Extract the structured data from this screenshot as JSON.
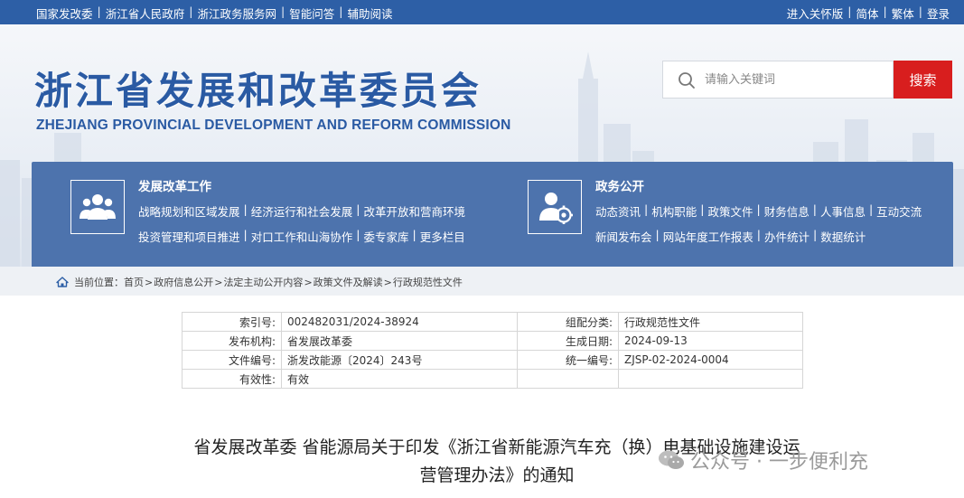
{
  "topbar": {
    "left_links": [
      "国家发改委",
      "浙江省人民政府",
      "浙江政务服务网",
      "智能问答",
      "辅助阅读"
    ],
    "right_links": [
      "进入关怀版",
      "简体",
      "繁体",
      "登录"
    ]
  },
  "header": {
    "title_cn": "浙江省发展和改革委员会",
    "title_en": "ZHEJIANG PROVINCIAL DEVELOPMENT AND REFORM COMMISSION"
  },
  "search": {
    "placeholder": "请输入关键词",
    "button_label": "搜索"
  },
  "nav": {
    "reform": {
      "title": "发展改革工作",
      "line1": [
        "战略规划和区域发展",
        "经济运行和社会发展",
        "改革开放和营商环境"
      ],
      "line2": [
        "投资管理和项目推进",
        "对口工作和山海协作",
        "委专家库",
        "更多栏目"
      ]
    },
    "gov": {
      "title": "政务公开",
      "line1": [
        "动态资讯",
        "机构职能",
        "政策文件",
        "财务信息",
        "人事信息",
        "互动交流"
      ],
      "line2": [
        "新闻发布会",
        "网站年度工作报表",
        "办件统计",
        "数据统计"
      ]
    }
  },
  "breadcrumb": {
    "prefix": "当前位置：",
    "items": [
      "首页",
      "政府信息公开",
      "法定主动公开内容",
      "政策文件及解读",
      "行政规范性文件"
    ]
  },
  "info": {
    "index_label": "索引号:",
    "index_value": "002482031/2024-38924",
    "category_label": "组配分类:",
    "category_value": "行政规范性文件",
    "publisher_label": "发布机构:",
    "publisher_value": "省发展改革委",
    "date_label": "生成日期:",
    "date_value": "2024-09-13",
    "docno_label": "文件编号:",
    "docno_value": "浙发改能源〔2024〕243号",
    "unified_label": "统一编号:",
    "unified_value": "ZJSP-02-2024-0004",
    "validity_label": "有效性:",
    "validity_value": "有效"
  },
  "article": {
    "title_line1": "省发展改革委 省能源局关于印发《浙江省新能源汽车充（换）电基础设施建设运",
    "title_line2": "营管理办法》的通知"
  },
  "watermark": {
    "text": "公众号 · 一步便利充"
  },
  "colors": {
    "topbar": "#2d5fa6",
    "brand_blue": "#2a5aa3",
    "nav_panel": "#4d73ad",
    "search_button": "#d81e1e"
  }
}
